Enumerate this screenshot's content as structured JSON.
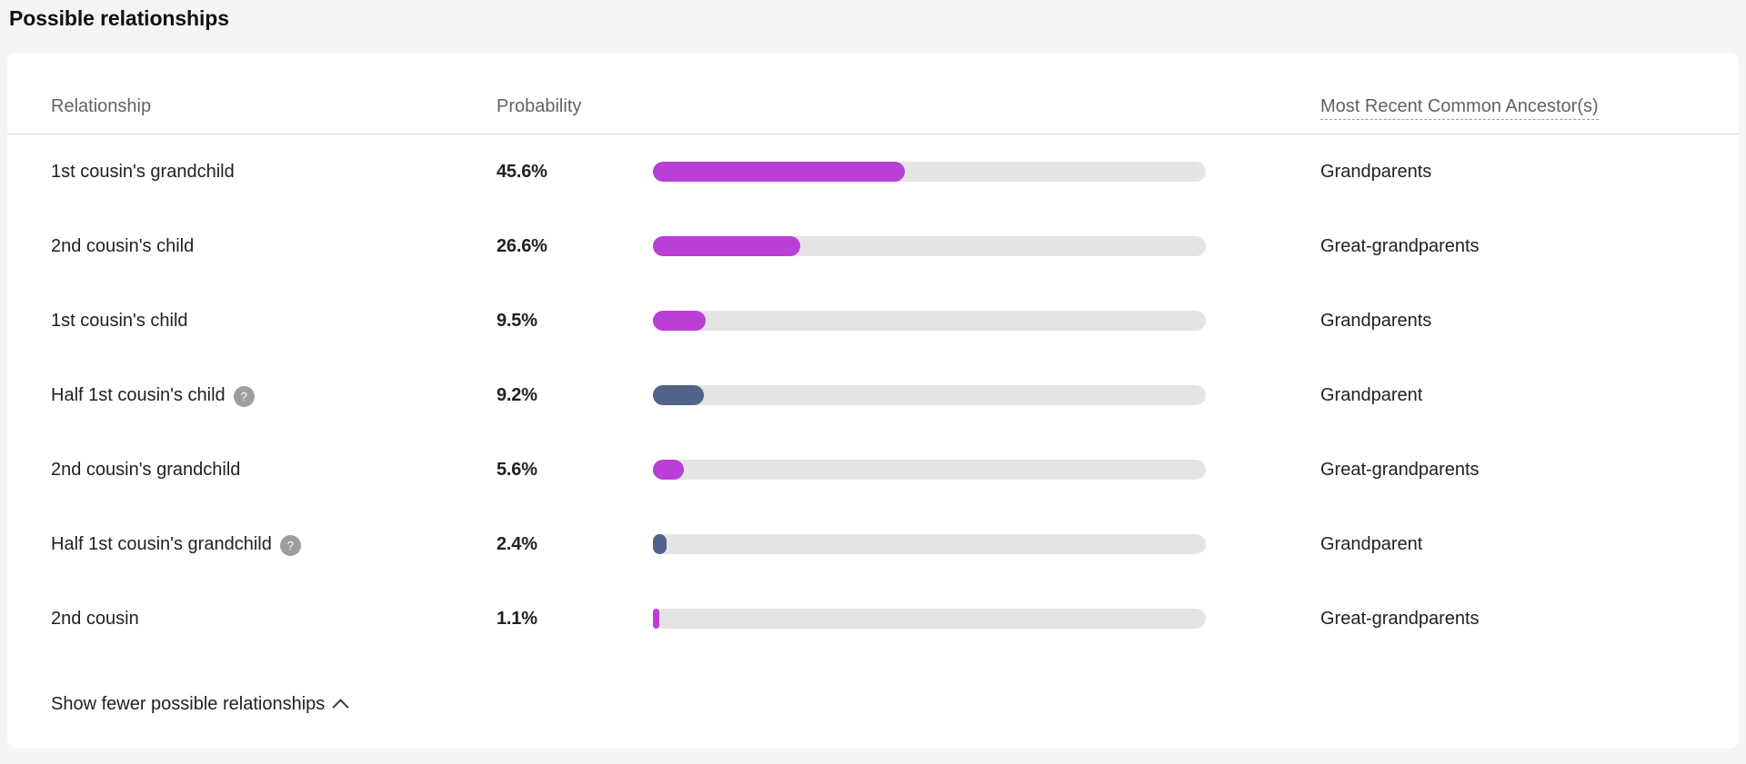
{
  "section": {
    "title": "Possible relationships"
  },
  "table": {
    "columns": {
      "relationship": "Relationship",
      "probability": "Probability",
      "mrca": "Most Recent Common Ancestor(s)"
    },
    "rows": [
      {
        "relationship": "1st cousin's grandchild",
        "has_help": false,
        "help_glyph": "?",
        "probability_label": "45.6%",
        "probability_value": 45.6,
        "bar_color": "#b93fd6",
        "mrca": "Grandparents"
      },
      {
        "relationship": "2nd cousin's child",
        "has_help": false,
        "help_glyph": "?",
        "probability_label": "26.6%",
        "probability_value": 26.6,
        "bar_color": "#b93fd6",
        "mrca": "Great-grandparents"
      },
      {
        "relationship": "1st cousin's child",
        "has_help": false,
        "help_glyph": "?",
        "probability_label": "9.5%",
        "probability_value": 9.5,
        "bar_color": "#b93fd6",
        "mrca": "Grandparents"
      },
      {
        "relationship": "Half 1st cousin's child",
        "has_help": true,
        "help_glyph": "?",
        "probability_label": "9.2%",
        "probability_value": 9.2,
        "bar_color": "#4f6488",
        "mrca": "Grandparent"
      },
      {
        "relationship": "2nd cousin's grandchild",
        "has_help": false,
        "help_glyph": "?",
        "probability_label": "5.6%",
        "probability_value": 5.6,
        "bar_color": "#b93fd6",
        "mrca": "Great-grandparents"
      },
      {
        "relationship": "Half 1st cousin's grandchild",
        "has_help": true,
        "help_glyph": "?",
        "probability_label": "2.4%",
        "probability_value": 2.4,
        "bar_color": "#4f6488",
        "mrca": "Grandparent"
      },
      {
        "relationship": "2nd cousin",
        "has_help": false,
        "help_glyph": "?",
        "probability_label": "1.1%",
        "probability_value": 1.1,
        "bar_color": "#b93fd6",
        "mrca": "Great-grandparents"
      }
    ]
  },
  "footer": {
    "toggle_label": "Show fewer possible relationships",
    "toggle_icon": "chevron-up-icon"
  },
  "colors": {
    "page_background": "#f5f5f5",
    "card_background": "#ffffff",
    "bar_track": "#e4e4e4",
    "bar_full": "#b93fd6",
    "bar_half": "#4f6488",
    "help_badge": "#9e9e9e",
    "header_text": "#5f6368",
    "body_text": "#202124",
    "divider": "#d6d6d6"
  },
  "chart_data": {
    "type": "bar",
    "title": "Possible relationships",
    "xlabel": "Probability",
    "ylabel": "Relationship",
    "categories": [
      "1st cousin's grandchild",
      "2nd cousin's child",
      "1st cousin's child",
      "Half 1st cousin's child",
      "2nd cousin's grandchild",
      "Half 1st cousin's grandchild",
      "2nd cousin"
    ],
    "values": [
      45.6,
      26.6,
      9.5,
      9.2,
      5.6,
      2.4,
      1.1
    ],
    "value_labels": [
      "45.6%",
      "26.6%",
      "9.5%",
      "9.2%",
      "5.6%",
      "2.4%",
      "1.1%"
    ],
    "bar_colors": [
      "#b93fd6",
      "#b93fd6",
      "#b93fd6",
      "#4f6488",
      "#b93fd6",
      "#4f6488",
      "#b93fd6"
    ],
    "annotations": [
      "Grandparents",
      "Great-grandparents",
      "Grandparents",
      "Grandparent",
      "Great-grandparents",
      "Grandparent",
      "Great-grandparents"
    ],
    "xlim": [
      0,
      100
    ],
    "grid": false,
    "legend": false,
    "orientation": "horizontal"
  }
}
